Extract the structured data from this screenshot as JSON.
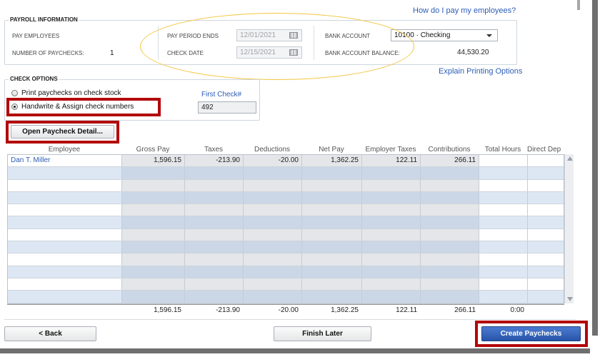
{
  "help_link": "How do I pay my employees?",
  "explain_link": "Explain Printing Options",
  "payroll_info": {
    "title": "PAYROLL INFORMATION",
    "pay_employees_label": "PAY EMPLOYEES",
    "num_paychecks_label": "NUMBER OF PAYCHECKS:",
    "num_paychecks_value": "1",
    "pay_period_ends_label": "PAY PERIOD ENDS",
    "pay_period_ends_value": "12/01/2021",
    "check_date_label": "CHECK DATE",
    "check_date_value": "12/15/2021",
    "bank_account_label": "BANK ACCOUNT",
    "bank_account_value": "10100 · Checking",
    "bank_balance_label": "BANK ACCOUNT BALANCE:",
    "bank_balance_value": "44,530.20"
  },
  "check_options": {
    "title": "CHECK OPTIONS",
    "option_print": "Print paychecks on check stock",
    "option_handwrite": "Handwrite & Assign check numbers",
    "selected": "handwrite",
    "first_check_label": "First Check#",
    "first_check_value": "492"
  },
  "open_detail_button": "Open Paycheck Detail...",
  "grid": {
    "columns": [
      "Employee",
      "Gross Pay",
      "Taxes",
      "Deductions",
      "Net Pay",
      "Employer Taxes",
      "Contributions",
      "Total Hours",
      "Direct Dep"
    ],
    "rows": [
      [
        "Dan T. Miller",
        "1,596.15",
        "-213.90",
        "-20.00",
        "1,362.25",
        "122.11",
        "266.11",
        "",
        ""
      ]
    ],
    "totals": [
      "",
      "1,596.15",
      "-213.90",
      "-20.00",
      "1,362.25",
      "122.11",
      "266.11",
      "0:00",
      ""
    ]
  },
  "buttons": {
    "back": "< Back",
    "finish_later": "Finish Later",
    "create": "Create Paychecks"
  },
  "colors": {
    "highlight_red": "#b3070b",
    "ellipse_yellow": "#f3c640",
    "link_blue": "#2c5db6",
    "primary_button": "#2754a8"
  }
}
